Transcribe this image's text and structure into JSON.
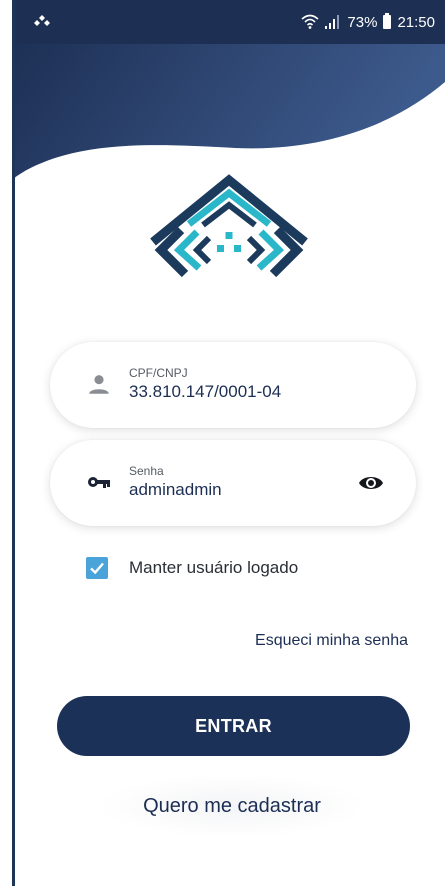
{
  "status_bar": {
    "left_icon": "sync-status-icon",
    "wifi_icon": "wifi-icon",
    "signal_icon": "signal-icon",
    "battery_percent": "73%",
    "battery_icon": "battery-icon",
    "time": "21:50"
  },
  "logo": {
    "icon": "app-logo-icon"
  },
  "login": {
    "cpf": {
      "label": "CPF/CNPJ",
      "value": "33.810.147/0001-04",
      "icon": "person-icon"
    },
    "senha": {
      "label": "Senha",
      "value": "adminadmin",
      "icon": "key-icon",
      "toggle_icon": "eye-icon"
    },
    "remember": {
      "label": "Manter usuário logado",
      "checked": true
    },
    "forgot_label": "Esqueci minha senha",
    "submit_label": "ENTRAR",
    "register_label": "Quero me cadastrar"
  },
  "colors": {
    "primary": "#1c3157",
    "accent": "#4aa3d9",
    "logo_teal": "#29b7c9",
    "logo_navy": "#1b3a5c"
  }
}
